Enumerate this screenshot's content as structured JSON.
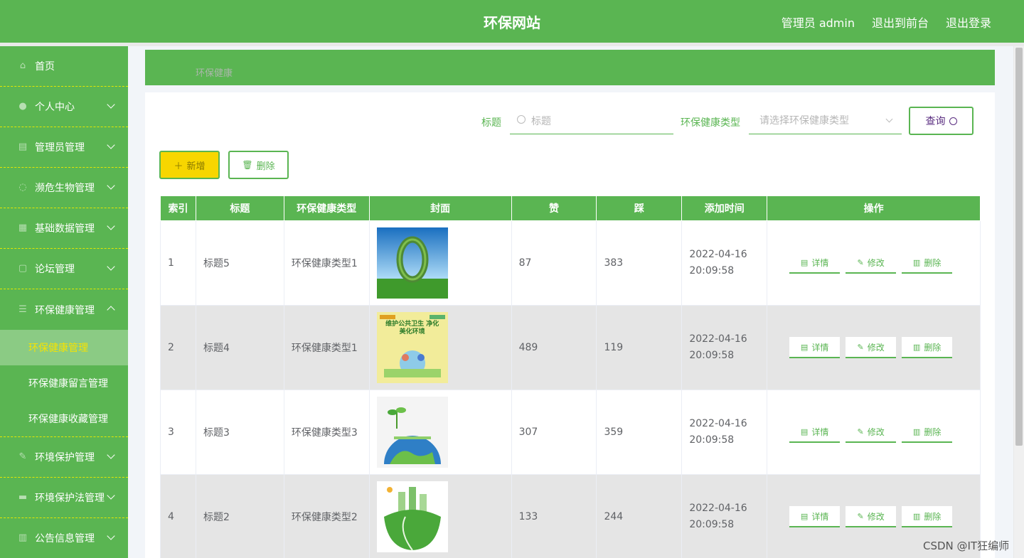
{
  "header": {
    "title": "环保网站",
    "user": "管理员 admin",
    "to_front": "退出到前台",
    "logout": "退出登录"
  },
  "sidebar": {
    "items": [
      {
        "label": "首页",
        "icon": "home-icon"
      },
      {
        "label": "个人中心",
        "icon": "user-icon"
      },
      {
        "label": "管理员管理",
        "icon": "admin-icon"
      },
      {
        "label": "濒危生物管理",
        "icon": "creature-icon"
      },
      {
        "label": "基础数据管理",
        "icon": "grid-icon"
      },
      {
        "label": "论坛管理",
        "icon": "forum-icon"
      },
      {
        "label": "环保健康管理",
        "icon": "health-icon"
      }
    ],
    "sub_items": [
      "环保健康管理",
      "环保健康留言管理",
      "环保健康收藏管理"
    ],
    "items_after": [
      {
        "label": "环境保护管理",
        "icon": "env-icon"
      },
      {
        "label": "环境保护法管理",
        "icon": "law-icon"
      },
      {
        "label": "公告信息管理",
        "icon": "notice-icon"
      }
    ]
  },
  "breadcrumb": "环保健康",
  "search": {
    "title_label": "标题",
    "title_placeholder": "标题",
    "type_label": "环保健康类型",
    "type_placeholder": "请选择环保健康类型",
    "query_button": "查询"
  },
  "toolbar": {
    "add": "新增",
    "delete": "删除"
  },
  "table": {
    "headers": [
      "索引",
      "标题",
      "环保健康类型",
      "封面",
      "赞",
      "踩",
      "添加时间",
      "操作"
    ],
    "rows": [
      {
        "index": "1",
        "title": "标题5",
        "type": "环保健康类型1",
        "likes": "87",
        "dislikes": "383",
        "time": "2022-04-16 20:09:58"
      },
      {
        "index": "2",
        "title": "标题4",
        "type": "环保健康类型1",
        "likes": "489",
        "dislikes": "119",
        "time": "2022-04-16 20:09:58"
      },
      {
        "index": "3",
        "title": "标题3",
        "type": "环保健康类型3",
        "likes": "307",
        "dislikes": "359",
        "time": "2022-04-16 20:09:58"
      },
      {
        "index": "4",
        "title": "标题2",
        "type": "环保健康类型2",
        "likes": "133",
        "dislikes": "244",
        "time": "2022-04-16 20:09:58"
      }
    ],
    "ops": {
      "detail": "详情",
      "edit": "修改",
      "delete": "删除"
    }
  },
  "cover_poster_text": "维护公共卫生 净化美化环境",
  "watermark": "CSDN @IT狂编师",
  "colors": {
    "primary": "#5ab552",
    "accent": "#f7d600",
    "active_sub": "#8bcb84"
  }
}
